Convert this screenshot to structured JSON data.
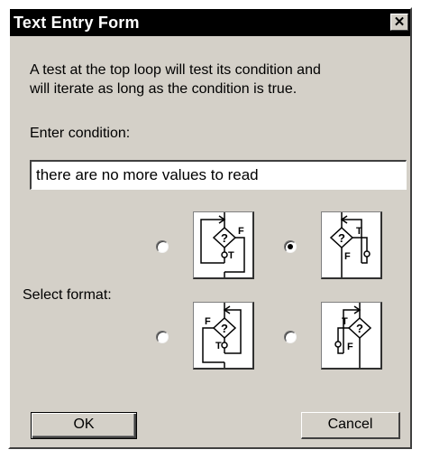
{
  "window": {
    "title": "Text Entry Form",
    "close_glyph": "✕"
  },
  "description": {
    "line1": "A test at the top loop will test its condition and",
    "line2": "will iterate as long as the condition is true."
  },
  "condition": {
    "label": "Enter condition:",
    "value": "there are no more values to read"
  },
  "format": {
    "label": "Select format:",
    "selected_index": 1,
    "options": [
      {
        "icon": "flowchart-loop-true-down-false-right-icon",
        "true_label": "T",
        "false_label": "F",
        "decision_label": "?"
      },
      {
        "icon": "flowchart-loop-true-right-false-down-icon",
        "true_label": "T",
        "false_label": "F",
        "decision_label": "?"
      },
      {
        "icon": "flowchart-loop-true-down-false-left-icon",
        "true_label": "T",
        "false_label": "F",
        "decision_label": "?"
      },
      {
        "icon": "flowchart-loop-true-left-false-down-icon",
        "true_label": "T",
        "false_label": "F",
        "decision_label": "?"
      }
    ]
  },
  "buttons": {
    "ok_label": "OK",
    "cancel_label": "Cancel"
  }
}
